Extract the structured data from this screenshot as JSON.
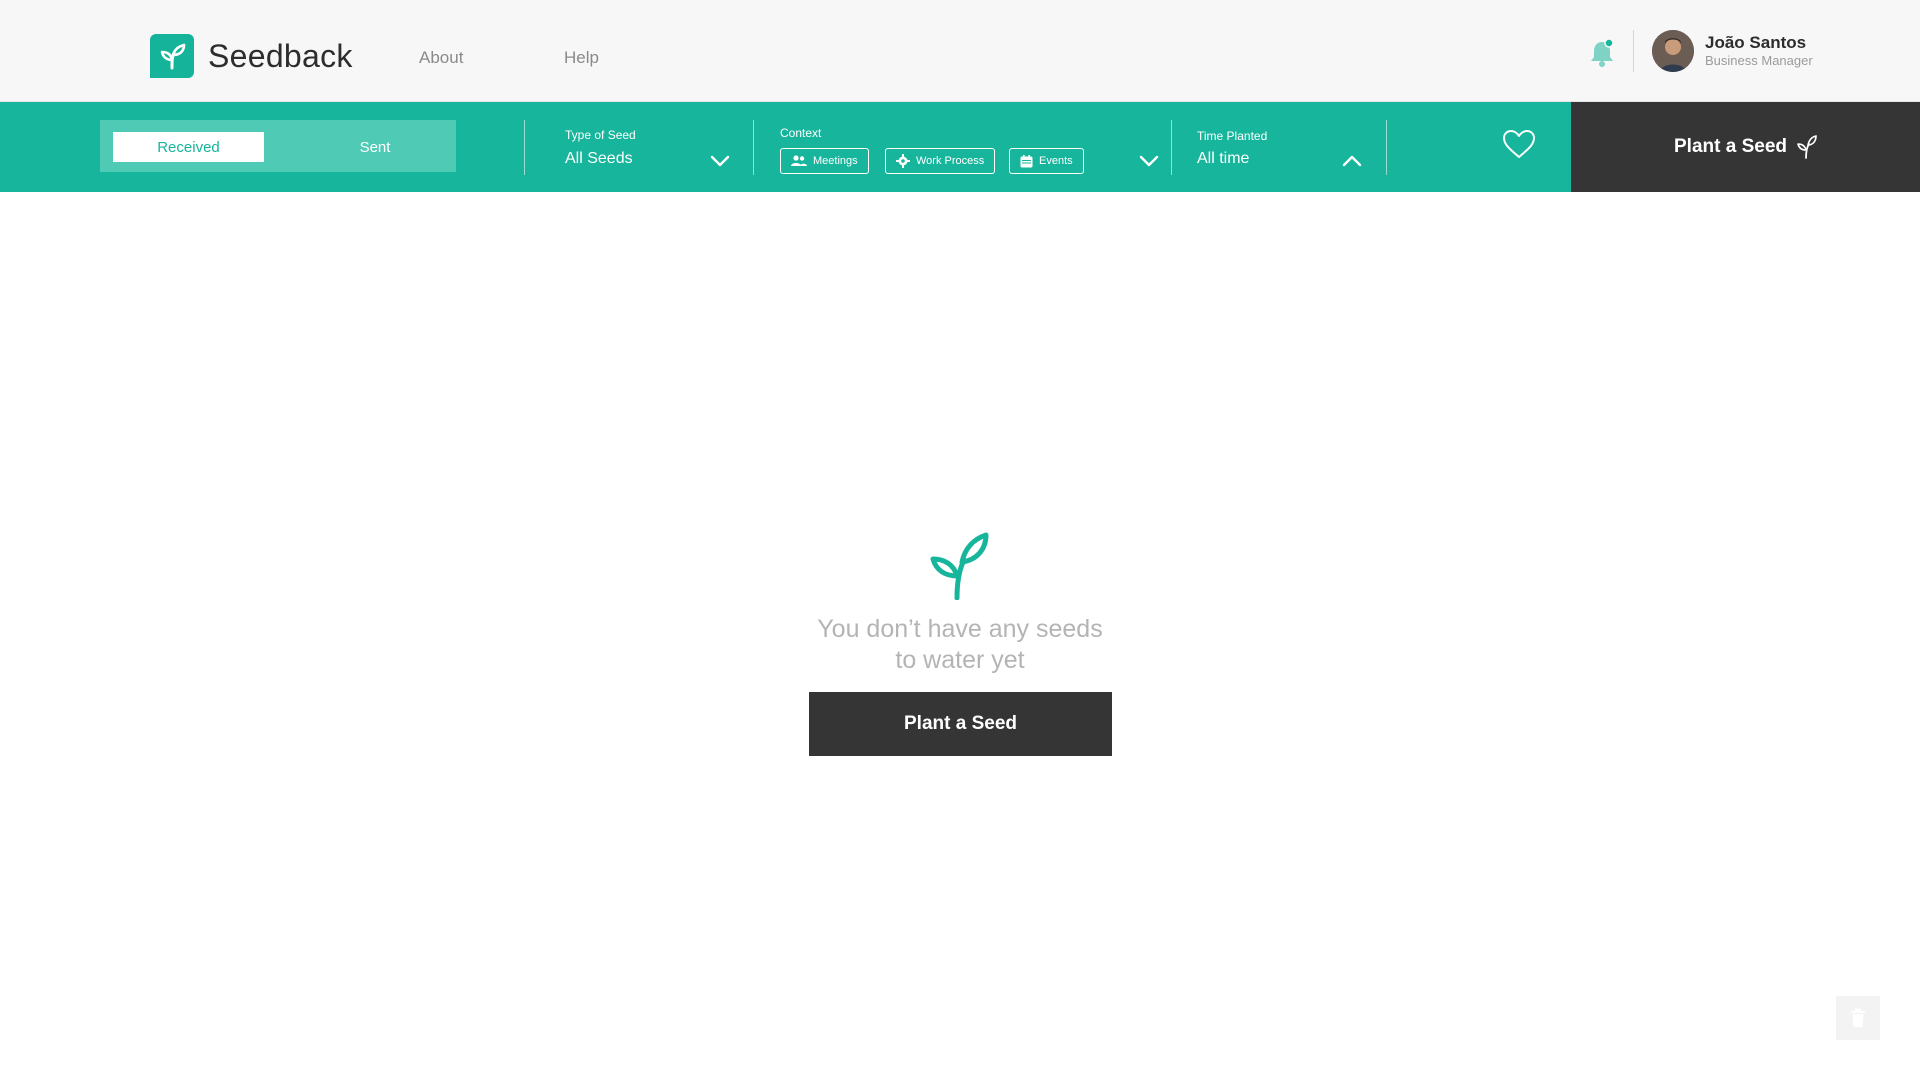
{
  "app": {
    "name": "Seedback"
  },
  "nav": {
    "about": "About",
    "help": "Help"
  },
  "user": {
    "name": "João Santos",
    "role": "Business Manager"
  },
  "filters": {
    "toggle": {
      "received": "Received",
      "sent": "Sent",
      "active": "Received"
    },
    "type_of_seed": {
      "label": "Type of Seed",
      "value": "All Seeds"
    },
    "context": {
      "label": "Context",
      "chips": [
        {
          "label": "Meetings",
          "icon": "people-icon"
        },
        {
          "label": "Work Process",
          "icon": "gear-icon"
        },
        {
          "label": "Events",
          "icon": "calendar-icon"
        }
      ]
    },
    "time_planted": {
      "label": "Time Planted",
      "value": "All time"
    }
  },
  "actions": {
    "plant_top": "Plant a Seed",
    "plant_main": "Plant a Seed"
  },
  "empty_state": {
    "line1": "You don’t have any seeds",
    "line2": "to water yet"
  },
  "colors": {
    "brand": "#17b59c",
    "dark": "#353535",
    "muted_text": "#b4b4b4"
  }
}
